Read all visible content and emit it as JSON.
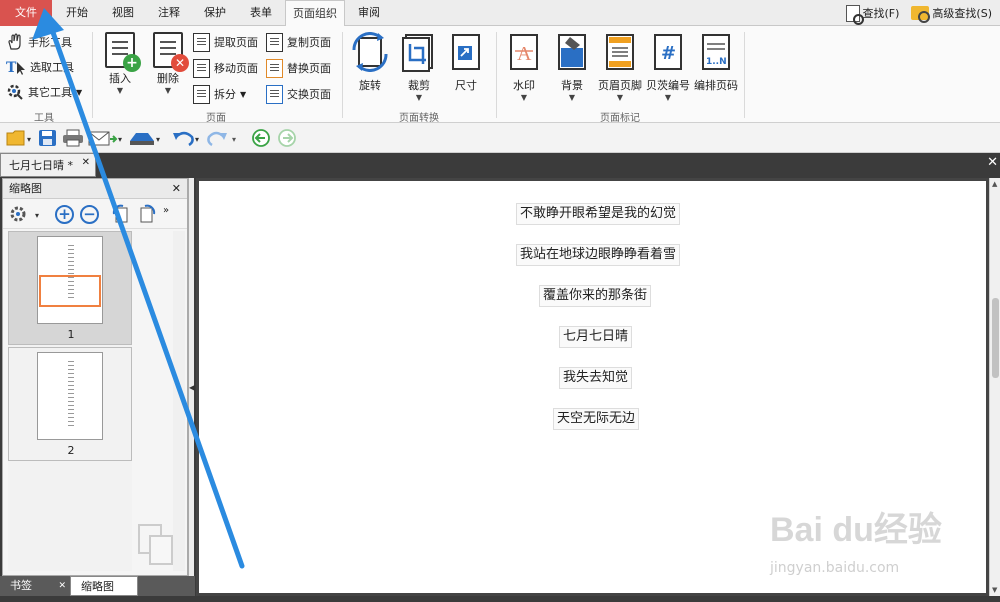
{
  "tabs": [
    "文件",
    "开始",
    "视图",
    "注释",
    "保护",
    "表单",
    "页面组织",
    "审阅"
  ],
  "find": {
    "find_label": "查找(F)",
    "adv_label": "高级查找(S)"
  },
  "tools_group": {
    "label": "工具",
    "items": [
      "手形工具",
      "选取工具",
      "其它工具"
    ]
  },
  "page_group": {
    "label": "页面",
    "insert": "插入",
    "delete": "删除",
    "extract": "提取页面",
    "move": "移动页面",
    "split": "拆分",
    "copy": "复制页面",
    "replace": "替换页面",
    "swap": "交换页面"
  },
  "transform_group": {
    "label": "页面转换",
    "rotate": "旋转",
    "crop": "裁剪",
    "size": "尺寸"
  },
  "mark_group": {
    "label": "页面标记",
    "watermark": "水印",
    "background": "背景",
    "header_footer": "页眉页脚",
    "bates": "贝茨编号",
    "page_number": "编排页码",
    "pn_icon_text": "1..N",
    "bates_icon_text": "#"
  },
  "doc_tab": {
    "title": "七月七日晴 *"
  },
  "left_panel": {
    "title": "缩略图",
    "pages": [
      "1",
      "2"
    ]
  },
  "bottom_tabs": {
    "bookmarks": "书签",
    "thumbnails": "缩略图"
  },
  "doc_lines": [
    "不敢睁开眼希望是我的幻觉",
    "我站在地球边眼睁睁看着雪",
    "覆盖你来的那条街",
    "七月七日晴",
    "我失去知觉",
    "天空无际无边"
  ],
  "watermark": {
    "brand": "Bai du经验",
    "url": "jingyan.baidu.com"
  },
  "colors": {
    "file_tab": "#d9534f",
    "arrow": "#2b8be0",
    "accent_blue": "#2a6fc4",
    "insert_green": "#3aa345",
    "delete_red": "#e24c3c",
    "highlight_orange": "#f08040"
  }
}
